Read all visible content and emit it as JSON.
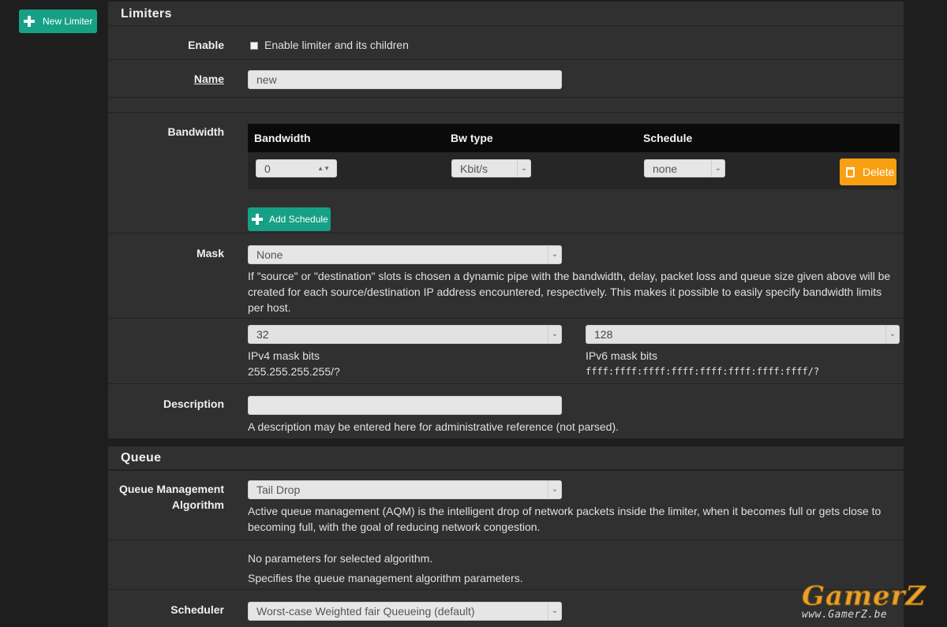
{
  "sidebar": {
    "new_limiter_label": "New Limiter"
  },
  "limiters": {
    "title": "Limiters",
    "enable": {
      "label": "Enable",
      "checkbox_label": "Enable limiter and its children"
    },
    "name": {
      "label": "Name",
      "value": "new"
    },
    "bandwidth": {
      "label": "Bandwidth",
      "columns": [
        "Bandwidth",
        "Bw type",
        "Schedule"
      ],
      "row": {
        "bandwidth": "0",
        "bw_type": "Kbit/s",
        "schedule": "none"
      },
      "delete_label": "Delete",
      "add_schedule_label": "Add Schedule"
    },
    "mask": {
      "label": "Mask",
      "value": "None",
      "help": "If \"source\" or \"destination\" slots is chosen a dynamic pipe with the bandwidth, delay, packet loss and queue size given above will be created for each source/destination IP address encountered, respectively. This makes it possible to easily specify bandwidth limits per host."
    },
    "ipv4": {
      "value": "32",
      "label": "IPv4 mask bits",
      "mask": "255.255.255.255/?"
    },
    "ipv6": {
      "value": "128",
      "label": "IPv6 mask bits",
      "mask": "ffff:ffff:ffff:ffff:ffff:ffff:ffff:ffff/?"
    },
    "description": {
      "label": "Description",
      "value": "",
      "help": "A description may be entered here for administrative reference (not parsed)."
    }
  },
  "queue": {
    "title": "Queue",
    "aqm": {
      "label_line1": "Queue Management",
      "label_line2": "Algorithm",
      "value": "Tail Drop",
      "help": "Active queue management (AQM) is the intelligent drop of network packets inside the limiter, when it becomes full or gets close to becoming full, with the goal of reducing network congestion."
    },
    "params": {
      "text": "No parameters for selected algorithm.",
      "help": "Specifies the queue management algorithm parameters."
    },
    "scheduler": {
      "label": "Scheduler",
      "value": "Worst-case Weighted fair Queueing (default)"
    }
  },
  "watermark": {
    "title": "GamerZ",
    "subtitle": "www.GamerZ.be"
  },
  "colors": {
    "accent": "#16a085",
    "delete": "#f9a012",
    "panel": "#303030",
    "background": "#1e1e1e"
  },
  "icons": {
    "add": "plus-icon",
    "delete": "trash-icon",
    "dropdown": "chevron-down-icon",
    "spinner": "spinner-arrows-icon"
  }
}
